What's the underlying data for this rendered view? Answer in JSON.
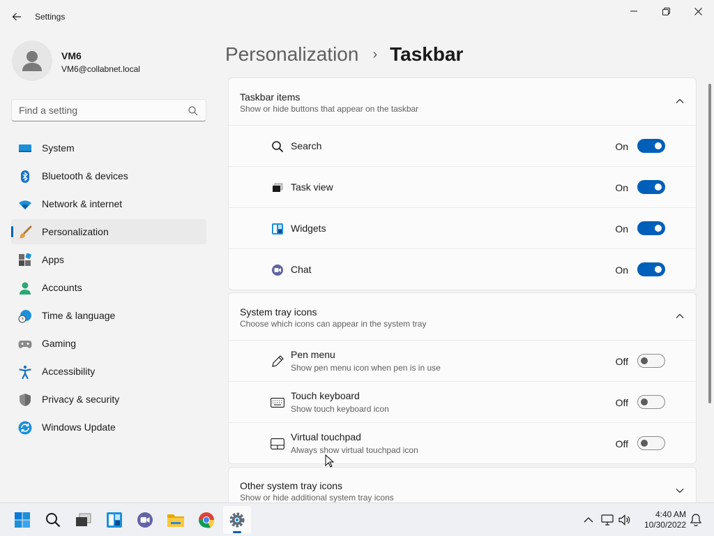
{
  "window": {
    "app_title": "Settings"
  },
  "user": {
    "name": "VM6",
    "email": "VM6@collabnet.local"
  },
  "search": {
    "placeholder": "Find a setting"
  },
  "nav": {
    "items": [
      {
        "label": "System",
        "icon": "system-icon"
      },
      {
        "label": "Bluetooth & devices",
        "icon": "bluetooth-icon"
      },
      {
        "label": "Network & internet",
        "icon": "wifi-icon"
      },
      {
        "label": "Personalization",
        "icon": "brush-icon",
        "active": true
      },
      {
        "label": "Apps",
        "icon": "apps-icon"
      },
      {
        "label": "Accounts",
        "icon": "accounts-icon"
      },
      {
        "label": "Time & language",
        "icon": "globe-clock-icon"
      },
      {
        "label": "Gaming",
        "icon": "gamepad-icon"
      },
      {
        "label": "Accessibility",
        "icon": "accessibility-icon"
      },
      {
        "label": "Privacy & security",
        "icon": "shield-icon"
      },
      {
        "label": "Windows Update",
        "icon": "update-icon"
      }
    ]
  },
  "breadcrumb": {
    "parent": "Personalization",
    "separator": "›",
    "current": "Taskbar"
  },
  "taskbar_items": {
    "title": "Taskbar items",
    "subtitle": "Show or hide buttons that appear on the taskbar",
    "expanded": true,
    "rows": [
      {
        "label": "Search",
        "state": "On",
        "icon": "search-icon"
      },
      {
        "label": "Task view",
        "state": "On",
        "icon": "task-view-icon"
      },
      {
        "label": "Widgets",
        "state": "On",
        "icon": "widgets-icon"
      },
      {
        "label": "Chat",
        "state": "On",
        "icon": "chat-icon"
      }
    ]
  },
  "system_tray": {
    "title": "System tray icons",
    "subtitle": "Choose which icons can appear in the system tray",
    "expanded": true,
    "rows": [
      {
        "label": "Pen menu",
        "sub": "Show pen menu icon when pen is in use",
        "state": "Off",
        "icon": "pen-icon"
      },
      {
        "label": "Touch keyboard",
        "sub": "Show touch keyboard icon",
        "state": "Off",
        "icon": "keyboard-icon"
      },
      {
        "label": "Virtual touchpad",
        "sub": "Always show virtual touchpad icon",
        "state": "Off",
        "icon": "touchpad-icon"
      }
    ]
  },
  "other_tray": {
    "title": "Other system tray icons",
    "subtitle": "Show or hide additional system tray icons",
    "expanded": false
  },
  "os_taskbar": {
    "apps": [
      "start-icon",
      "search-icon",
      "task-view-icon",
      "widgets-icon",
      "chat-icon",
      "file-explorer-icon",
      "chrome-icon",
      "settings-icon"
    ],
    "active_app": "settings-icon",
    "time": "4:40 AM",
    "date": "10/30/2022"
  },
  "colors": {
    "accent": "#005fb8",
    "background": "#f3f3f3",
    "card": "#fbfbfb"
  }
}
